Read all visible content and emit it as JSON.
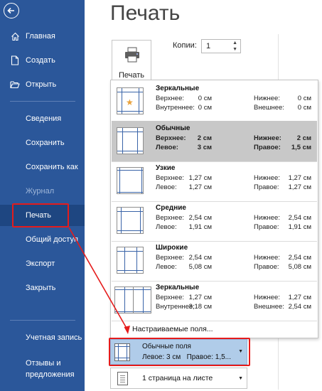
{
  "sidebar": {
    "items": [
      {
        "label": "Главная",
        "icon": "home-icon"
      },
      {
        "label": "Создать",
        "icon": "new-document-icon"
      },
      {
        "label": "Открыть",
        "icon": "open-folder-icon"
      },
      {
        "label": "Сведения"
      },
      {
        "label": "Сохранить"
      },
      {
        "label": "Сохранить как"
      },
      {
        "label": "Журнал"
      },
      {
        "label": "Печать"
      },
      {
        "label": "Общий доступ"
      },
      {
        "label": "Экспорт"
      },
      {
        "label": "Закрыть"
      },
      {
        "label": "Учетная запись"
      }
    ],
    "feedback": {
      "line1": "Отзывы и",
      "line2": "предложения"
    },
    "accent": "#2b579a"
  },
  "main": {
    "title": "Печать",
    "print_button": "Печать",
    "copies": {
      "label": "Копии:",
      "value": "1"
    }
  },
  "margins_menu": {
    "options": [
      {
        "title": "Зеркальные",
        "l1": "Верхнее:",
        "v1": "0 см",
        "l2": "Нижнее:",
        "v2": "0 см",
        "l3": "Внутреннее:",
        "v3": "0 см",
        "l4": "Внешнее:",
        "v4": "0 см"
      },
      {
        "title": "Обычные",
        "l1": "Верхнее:",
        "v1": "2 см",
        "l2": "Нижнее:",
        "v2": "2 см",
        "l3": "Левое:",
        "v3": "3 см",
        "l4": "Правое:",
        "v4": "1,5 см"
      },
      {
        "title": "Узкие",
        "l1": "Верхнее:",
        "v1": "1,27 см",
        "l2": "Нижнее:",
        "v2": "1,27 см",
        "l3": "Левое:",
        "v3": "1,27 см",
        "l4": "Правое:",
        "v4": "1,27 см"
      },
      {
        "title": "Средние",
        "l1": "Верхнее:",
        "v1": "2,54 см",
        "l2": "Нижнее:",
        "v2": "2,54 см",
        "l3": "Левое:",
        "v3": "1,91 см",
        "l4": "Правое:",
        "v4": "1,91 см"
      },
      {
        "title": "Широкие",
        "l1": "Верхнее:",
        "v1": "2,54 см",
        "l2": "Нижнее:",
        "v2": "2,54 см",
        "l3": "Левое:",
        "v3": "5,08 см",
        "l4": "Правое:",
        "v4": "5,08 см"
      },
      {
        "title": "Зеркальные",
        "l1": "Верхнее:",
        "v1": "1,27 см",
        "l2": "Нижнее:",
        "v2": "1,27 см",
        "l3": "Внутреннее:",
        "v3": "3,18 см",
        "l4": "Внешнее:",
        "v4": "2,54 см"
      }
    ],
    "custom_label": "Настраиваемые поля..."
  },
  "current_margins": {
    "title": "Обычные поля",
    "left": "Левое: 3 см",
    "right": "Правое: 1,5..."
  },
  "pages_per_sheet": "1 страница на листе",
  "highlight_color": "#e51c1c"
}
